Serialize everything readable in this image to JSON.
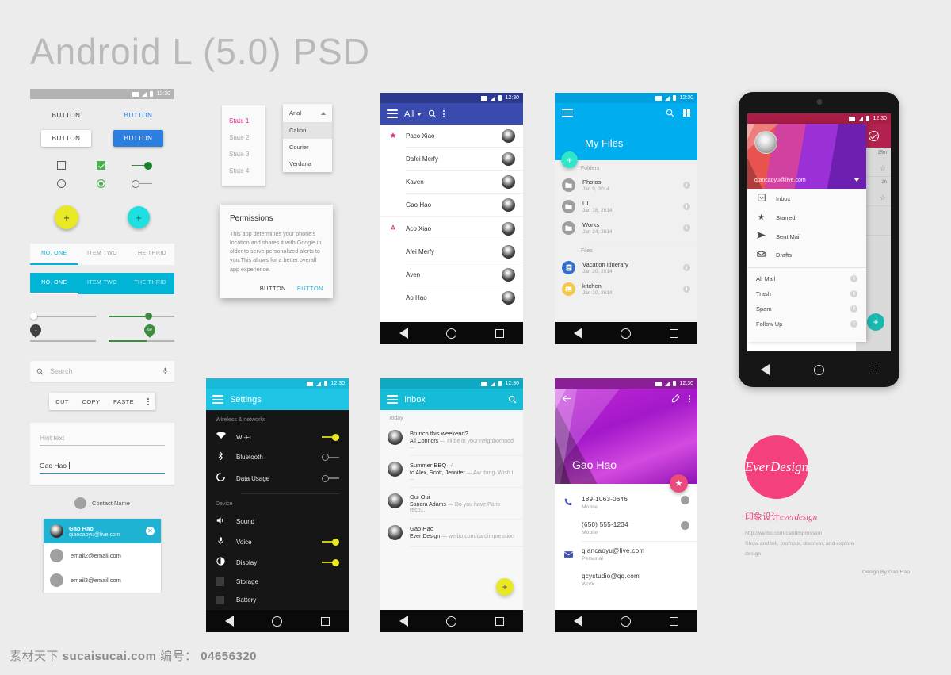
{
  "page": {
    "title": "Android L (5.0) PSD"
  },
  "status_bar": {
    "time": "12:30"
  },
  "widgets": {
    "flat_buttons": [
      {
        "label": "BUTTON",
        "style": "dark"
      },
      {
        "label": "BUTTON",
        "style": "blue"
      }
    ],
    "raised_buttons": [
      {
        "label": "BUTTON",
        "style": "white"
      },
      {
        "label": "BUTTON",
        "style": "blue"
      }
    ],
    "checkbox_off": "unchecked",
    "checkbox_on": "checked",
    "switch_on": "on",
    "radio_off": "unselected",
    "radio_on": "selected",
    "switch_off": "off",
    "fab_yellow": "+",
    "fab_cyan": "+",
    "tabs_light": [
      "NO. ONE",
      "ITEM TWO",
      "THE THRID"
    ],
    "tabs_dark": [
      "NO. ONE",
      "ITEM TWO",
      "THE THRID"
    ],
    "slider_pin_left": "1",
    "slider_pin_right": "60",
    "search_placeholder": "Search",
    "clipboard": [
      "CUT",
      "COPY",
      "PASTE"
    ],
    "hint_text": "Hint text",
    "filled_text": "Gao Hao",
    "contact_name": "Contact Name",
    "email_picker": {
      "selected_name": "Gao Hao",
      "selected_email": "qiancaoyu@live.com",
      "options": [
        "email2@email.com",
        "email3@email.com"
      ]
    }
  },
  "state_list": {
    "items": [
      "State 1",
      "State 2",
      "State 3",
      "State 4"
    ],
    "active": "State 1"
  },
  "font_dropdown": {
    "selected": "Arial",
    "options": [
      "Calibri",
      "Courier",
      "Verdana"
    ],
    "highlighted": "Calibri"
  },
  "permissions_dialog": {
    "title": "Permissions",
    "body": "This app determines your phone's location and shares it with Google in older to serve personalized alerts to you.This allows for a better overall app experience.",
    "cancel_label": "BUTTON",
    "confirm_label": "BUTTON"
  },
  "contacts_screen": {
    "filter": "All",
    "sections": [
      {
        "letter": "★",
        "rows": [
          {
            "name": "Paco Xiao"
          },
          {
            "name": "Dafei Merfy"
          },
          {
            "name": "Kaven"
          },
          {
            "name": "Gao Hao"
          }
        ]
      },
      {
        "letter": "A",
        "rows": [
          {
            "name": "Aco Xiao"
          },
          {
            "name": "Afei Merfy"
          },
          {
            "name": "Aven"
          },
          {
            "name": "Ao Hao"
          }
        ]
      }
    ]
  },
  "files_screen": {
    "title": "My Files",
    "fab": "+",
    "groups": [
      {
        "label": "Folders",
        "rows": [
          {
            "name": "Photos",
            "date": "Jan 9, 2014",
            "icon": "folder-icon",
            "color": "gray"
          },
          {
            "name": "UI",
            "date": "Jan 18, 2014",
            "icon": "folder-icon",
            "color": "gray"
          },
          {
            "name": "Works",
            "date": "Jan 24, 2014",
            "icon": "folder-icon",
            "color": "gray"
          }
        ]
      },
      {
        "label": "Files",
        "rows": [
          {
            "name": "Vacation Itinerary",
            "date": "Jan 20, 2014",
            "icon": "document-icon",
            "color": "blue"
          },
          {
            "name": "kitchen",
            "date": "Jan 10, 2014",
            "icon": "image-icon",
            "color": "yel"
          }
        ]
      }
    ]
  },
  "settings_screen": {
    "title": "Settings",
    "groups": [
      {
        "label": "Wireless & networks",
        "rows": [
          {
            "label": "Wi-Fi",
            "icon": "wifi-icon",
            "toggle": "on"
          },
          {
            "label": "Bluetooth",
            "icon": "bluetooth-icon",
            "toggle": "off"
          },
          {
            "label": "Data Usage",
            "icon": "data-usage-icon",
            "toggle": "off"
          }
        ]
      },
      {
        "label": "Device",
        "rows": [
          {
            "label": "Sound",
            "icon": "volume-icon",
            "toggle": "none"
          },
          {
            "label": "Voice",
            "icon": "mic-icon",
            "toggle": "on"
          },
          {
            "label": "Display",
            "icon": "brightness-icon",
            "toggle": "on"
          },
          {
            "label": "Storage",
            "icon": "storage-icon",
            "toggle": "none"
          },
          {
            "label": "Battery",
            "icon": "battery-icon",
            "toggle": "none"
          }
        ]
      }
    ]
  },
  "inbox_screen": {
    "title": "Inbox",
    "section": "Today",
    "fab": "+",
    "messages": [
      {
        "subject": "Brunch this weekend?",
        "count": "",
        "sender": "Ali Connors",
        "snippet": "— I'll be in your neighborhood ..."
      },
      {
        "subject": "Summer BBQ",
        "count": "4",
        "sender": "to Alex, Scott, Jennifer",
        "snippet": "— Aw dang. Wish I ..."
      },
      {
        "subject": "Oui Oui",
        "count": "",
        "sender": "Sandra Adams",
        "snippet": "— Do you have Paris reco..."
      },
      {
        "subject": "Gao Hao",
        "count": "",
        "sender": "Ever Design",
        "snippet": "— weibo.com/cardimpression"
      }
    ]
  },
  "contact_detail": {
    "name": "Gao Hao",
    "fab": "★",
    "entries": [
      {
        "value": "189-1063-0646",
        "label": "Mobile",
        "icon": "phone-icon",
        "group": "phone"
      },
      {
        "value": "(650) 555-1234",
        "label": "Mobile",
        "icon": "",
        "group": "phone"
      },
      {
        "value": "qiancaoyu@live.com",
        "label": "Personal",
        "icon": "mail-icon",
        "group": "email"
      },
      {
        "value": "qcystudio@qq.com",
        "label": "Work",
        "icon": "",
        "group": "email"
      }
    ]
  },
  "device_screen": {
    "account_email": "qiancaoyu@live.com",
    "primary_items": [
      {
        "label": "Inbox",
        "icon": "inbox-icon"
      },
      {
        "label": "Starred",
        "icon": "star-icon"
      },
      {
        "label": "Sent Mail",
        "icon": "send-icon"
      },
      {
        "label": "Drafts",
        "icon": "drafts-icon"
      }
    ],
    "secondary_items": [
      {
        "label": "All Mail",
        "count": "0"
      },
      {
        "label": "Trash",
        "count": "0"
      },
      {
        "label": "Spam",
        "count": "0"
      },
      {
        "label": "Follow Up",
        "count": "0"
      }
    ],
    "list_times": [
      "15m",
      "2h"
    ],
    "fab": "+"
  },
  "brand": {
    "logo_text": "EverDesign",
    "cn_name": "印象设计",
    "cn_latin": "everdesign",
    "url": "http://weibo.com/cardimpression",
    "tagline_1": "Show and tell, promote, discover, and explore",
    "tagline_2": "design",
    "credit": "Design By Gao Hao"
  },
  "footer": {
    "cn": "素材天下",
    "site": "sucaisucai.com",
    "id_label": "编号：",
    "id_value": "04656320"
  },
  "colors": {
    "blue_accent": "#2a7fe0",
    "cyan": "#00b5d6",
    "teal": "#1fc5e4",
    "yellow": "#e8e824",
    "pink": "#e0218a",
    "green": "#3d8b40",
    "indigo": "#3a4bb0",
    "light_blue": "#00aeef",
    "purple": "#c327d6",
    "brand_pink": "#f4417e"
  }
}
